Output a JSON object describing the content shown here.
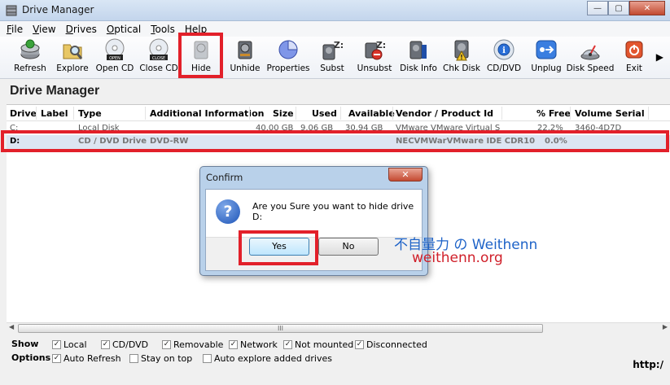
{
  "window": {
    "title": "Drive Manager",
    "minimize": "—",
    "maximize": "▢",
    "close": "✕"
  },
  "menu": [
    "File",
    "View",
    "Drives",
    "Optical",
    "Tools",
    "Help"
  ],
  "toolbar": {
    "buttons": [
      {
        "label": "Refresh",
        "icon": "refresh-icon"
      },
      {
        "label": "Explore",
        "icon": "explore-icon"
      },
      {
        "label": "Open CD",
        "icon": "open-cd-icon"
      },
      {
        "label": "Close CD",
        "icon": "close-cd-icon"
      },
      {
        "label": "Hide",
        "icon": "hide-icon"
      },
      {
        "label": "Unhide",
        "icon": "unhide-icon"
      },
      {
        "label": "Properties",
        "icon": "properties-icon"
      },
      {
        "label": "Subst",
        "icon": "subst-icon"
      },
      {
        "label": "Unsubst",
        "icon": "unsubst-icon"
      },
      {
        "label": "Disk Info",
        "icon": "disk-info-icon"
      },
      {
        "label": "Chk Disk",
        "icon": "chk-disk-icon"
      },
      {
        "label": "CD/DVD",
        "icon": "cd-dvd-icon"
      },
      {
        "label": "Unplug",
        "icon": "unplug-icon"
      },
      {
        "label": "Disk Speed",
        "icon": "disk-speed-icon"
      },
      {
        "label": "Exit",
        "icon": "exit-icon"
      }
    ],
    "more": "▶"
  },
  "heading": "Drive Manager",
  "table": {
    "columns": [
      "Drive",
      "Label",
      "Type",
      "Additional Information",
      "Size",
      "Used",
      "Available",
      "Vendor / Product Id",
      "% Free",
      "Volume Serial"
    ],
    "rows": [
      {
        "drive": "C:",
        "label": "",
        "type": "Local Disk",
        "info": "",
        "size": "40.00 GB",
        "used": "9.06 GB",
        "available": "30.94 GB",
        "vendor": "VMware VMware Virtual S",
        "free": "22.2%",
        "serial": "3460-4D7D"
      },
      {
        "drive": "D:",
        "label": "",
        "type": "CD / DVD Drive",
        "info": "DVD-RW",
        "size": "",
        "used": "",
        "available": "",
        "vendor": "NECVMWarVMware IDE CDR10",
        "free": "0.0%",
        "serial": ""
      }
    ]
  },
  "scroll": {
    "grip": "III",
    "left": "◀",
    "right": "▶"
  },
  "show": {
    "label": "Show",
    "items": [
      {
        "label": "Local",
        "checked": true
      },
      {
        "label": "CD/DVD",
        "checked": true
      },
      {
        "label": "Removable",
        "checked": true
      },
      {
        "label": "Network",
        "checked": true
      },
      {
        "label": "Not mounted",
        "checked": true
      },
      {
        "label": "Disconnected",
        "checked": true
      }
    ]
  },
  "options": {
    "label": "Options",
    "items": [
      {
        "label": "Auto Refresh",
        "checked": true
      },
      {
        "label": "Stay on top",
        "checked": false
      },
      {
        "label": "Auto explore added drives",
        "checked": false
      }
    ]
  },
  "footer_link": "http:/",
  "dialog": {
    "title": "Confirm",
    "close": "✕",
    "icon": "?",
    "message": "Are you Sure you want to hide drive D:",
    "yes": "Yes",
    "no": "No"
  },
  "watermark": {
    "line1": "不自量力 の Weithenn",
    "line2": "weithenn.org"
  },
  "colors": {
    "highlight": "#e2202a",
    "selected_row": "#dce5f2",
    "watermark_blue": "#1e63c8",
    "watermark_red": "#d0202a"
  }
}
